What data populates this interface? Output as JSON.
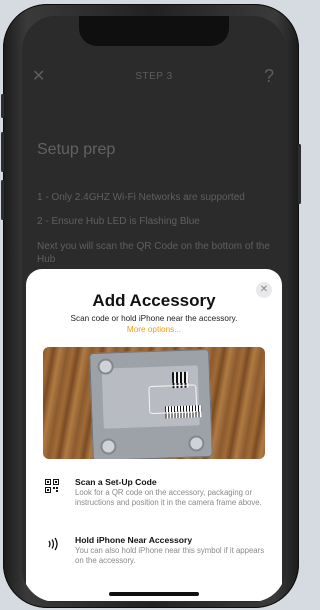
{
  "background_app": {
    "step_title": "STEP 3",
    "heading": "Setup prep",
    "lines": [
      "1 - Only 2.4GHZ Wi-Fi Networks are supported",
      "2 - Ensure Hub LED is Flashing Blue",
      "Next you will scan the QR Code on the bottom of the Hub"
    ]
  },
  "sheet": {
    "title": "Add Accessory",
    "subtitle": "Scan code or hold iPhone near the accessory.",
    "link": "More options...",
    "options": [
      {
        "title": "Scan a Set-Up Code",
        "description": "Look for a QR code on the accessory, packaging or instructions and position it in the camera frame above.",
        "icon": "qr-code-icon"
      },
      {
        "title": "Hold iPhone Near Accessory",
        "description": "You can also hold iPhone near this symbol if it appears on the accessory.",
        "icon": "nfc-icon"
      }
    ]
  },
  "colors": {
    "accent": "#f39c12",
    "sheet_bg": "#ffffff",
    "dim_bg": "#2b2b2b"
  }
}
